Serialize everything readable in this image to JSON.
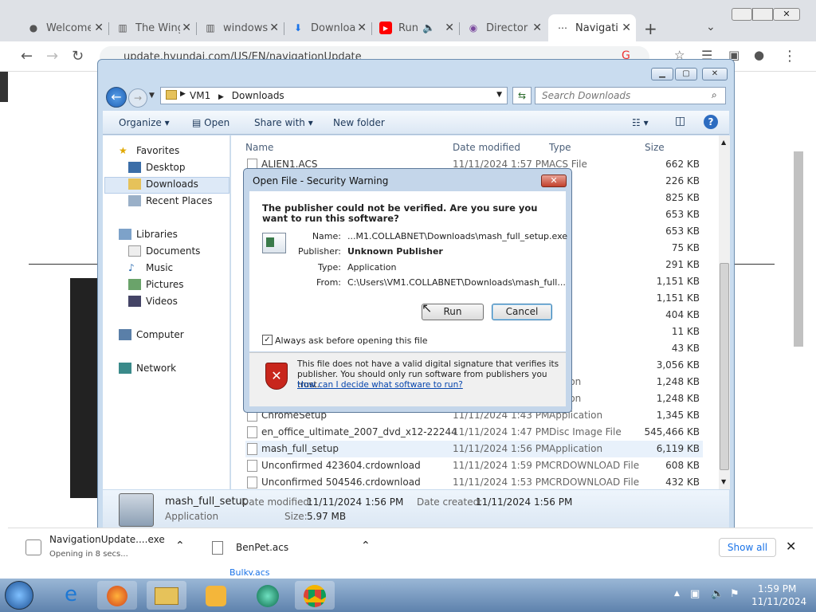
{
  "browser": {
    "tabs": [
      {
        "title": "Welcome",
        "icon": "github-icon"
      },
      {
        "title": "The Wing",
        "icon": "wiki-icon"
      },
      {
        "title": "windows",
        "icon": "wiki-icon"
      },
      {
        "title": "Downloa",
        "icon": "download-icon"
      },
      {
        "title": "Run",
        "icon": "youtube-icon"
      },
      {
        "title": "Director",
        "icon": "circle-icon"
      },
      {
        "title": "Navigati",
        "icon": "loading-icon"
      }
    ],
    "url": "update.hyundai.com/US/EN/navigationUpdate"
  },
  "explorer": {
    "path": [
      "VM1",
      "Downloads"
    ],
    "search_placeholder": "Search Downloads",
    "commands": {
      "organize": "Organize",
      "open": "Open",
      "share": "Share with",
      "new_folder": "New folder"
    },
    "nav": {
      "favorites": "Favorites",
      "desktop": "Desktop",
      "downloads": "Downloads",
      "recent": "Recent Places",
      "libraries": "Libraries",
      "documents": "Documents",
      "music": "Music",
      "pictures": "Pictures",
      "videos": "Videos",
      "computer": "Computer",
      "network": "Network"
    },
    "columns": {
      "name": "Name",
      "date": "Date modified",
      "type": "Type",
      "size": "Size"
    },
    "files": [
      {
        "name": "ALIEN1.ACS",
        "date": "11/11/2024 1:57 PM",
        "type": "ACS File",
        "size": "662 KB"
      },
      {
        "name": "",
        "date": "",
        "type": "ile",
        "size": "226 KB"
      },
      {
        "name": "",
        "date": "",
        "type": "ile",
        "size": "825 KB"
      },
      {
        "name": "",
        "date": "",
        "type": "ile",
        "size": "653 KB"
      },
      {
        "name": "",
        "date": "",
        "type": "ile",
        "size": "653 KB"
      },
      {
        "name": "",
        "date": "",
        "type": "ile",
        "size": "75 KB"
      },
      {
        "name": "",
        "date": "",
        "type": "ile",
        "size": "291 KB"
      },
      {
        "name": "",
        "date": "",
        "type": "ile",
        "size": "1,151 KB"
      },
      {
        "name": "",
        "date": "",
        "type": "ile",
        "size": "1,151 KB"
      },
      {
        "name": "",
        "date": "",
        "type": "ile",
        "size": "404 KB"
      },
      {
        "name": "",
        "date": "",
        "type": "ile",
        "size": "11 KB"
      },
      {
        "name": "",
        "date": "",
        "type": "ile",
        "size": "43 KB"
      },
      {
        "name": "",
        "date": "",
        "type": "ile",
        "size": "3,056 KB"
      },
      {
        "name": "",
        "date": "",
        "type": "ication",
        "size": "1,248 KB"
      },
      {
        "name": "",
        "date": "",
        "type": "ication",
        "size": "1,248 KB"
      },
      {
        "name": "ChromeSetup",
        "date": "11/11/2024 1:43 PM",
        "type": "Application",
        "size": "1,345 KB"
      },
      {
        "name": "en_office_ultimate_2007_dvd_x12-22244",
        "date": "11/11/2024 1:47 PM",
        "type": "Disc Image File",
        "size": "545,466 KB"
      },
      {
        "name": "mash_full_setup",
        "date": "11/11/2024 1:56 PM",
        "type": "Application",
        "size": "6,119 KB"
      },
      {
        "name": "Unconfirmed 423604.crdownload",
        "date": "11/11/2024 1:59 PM",
        "type": "CRDOWNLOAD File",
        "size": "608 KB"
      },
      {
        "name": "Unconfirmed 504546.crdownload",
        "date": "11/11/2024 1:53 PM",
        "type": "CRDOWNLOAD File",
        "size": "432 KB"
      }
    ],
    "details": {
      "name": "mash_full_setup",
      "kind": "Application",
      "date_modified_label": "Date modified:",
      "date_modified": "11/11/2024 1:56 PM",
      "date_created_label": "Date created:",
      "date_created": "11/11/2024 1:56 PM",
      "size_label": "Size:",
      "size": "5.97 MB"
    }
  },
  "dialog": {
    "title": "Open File - Security Warning",
    "heading": "The publisher could not be verified.  Are you sure you want to run this software?",
    "name_label": "Name:",
    "name": "...M1.COLLABNET\\Downloads\\mash_full_setup.exe",
    "publisher_label": "Publisher:",
    "publisher": "Unknown Publisher",
    "type_label": "Type:",
    "type": "Application",
    "from_label": "From:",
    "from": "C:\\Users\\VM1.COLLABNET\\Downloads\\mash_full...",
    "run": "Run",
    "cancel": "Cancel",
    "checkbox": "Always ask before opening this file",
    "warning": "This file does not have a valid digital signature that verifies its publisher.  You should only run software from publishers you trust.",
    "link": "How can I decide what software to run?"
  },
  "downloads_bar": {
    "item1": "NavigationUpdate....exe",
    "item1_status": "Opening in 8 secs...",
    "item2": "BenPet.acs",
    "item3": "Bulky.acs",
    "show_all": "Show all"
  },
  "taskbar": {
    "time": "1:59 PM",
    "date": "11/11/2024"
  }
}
